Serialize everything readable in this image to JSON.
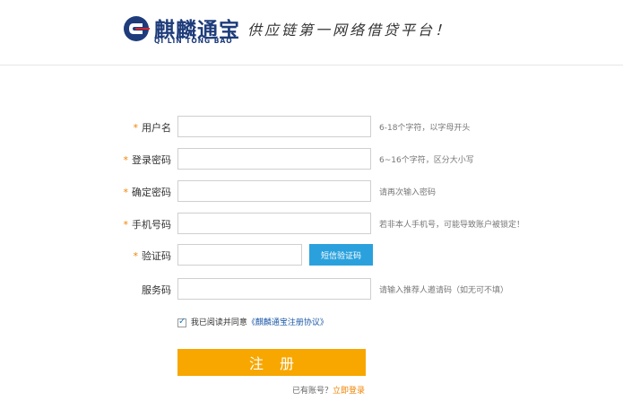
{
  "header": {
    "brand_name": "麒麟通宝",
    "brand_sub": "QI LIN TONG BAO",
    "slogan": "供应链第一网络借贷平台！"
  },
  "form": {
    "fields": [
      {
        "label": "用户名",
        "required": true,
        "hint": "6-18个字符，以字母开头",
        "value": ""
      },
      {
        "label": "登录密码",
        "required": true,
        "hint": "6~16个字符，区分大小写",
        "value": ""
      },
      {
        "label": "确定密码",
        "required": true,
        "hint": "请再次输入密码",
        "value": ""
      },
      {
        "label": "手机号码",
        "required": true,
        "hint": "若非本人手机号，可能导致账户被锁定！",
        "value": ""
      },
      {
        "label": "验证码",
        "required": true,
        "hint": "",
        "value": ""
      },
      {
        "label": "服务码",
        "required": false,
        "hint": "请输入推荐人邀请码（如无可不填）",
        "value": ""
      }
    ],
    "required_mark": "*",
    "sms_button": "短信验证码",
    "agree_text": "我已阅读并同意",
    "agree_link": "《麒麟通宝注册协议》",
    "agree_checked": true,
    "submit_label": "注册",
    "have_account": "已有账号？",
    "login_link": "立即登录"
  },
  "colors": {
    "brand_blue": "#1e3c7b",
    "accent_orange": "#f7a700",
    "sms_blue": "#2aa1dd",
    "required_star": "#f08300"
  }
}
